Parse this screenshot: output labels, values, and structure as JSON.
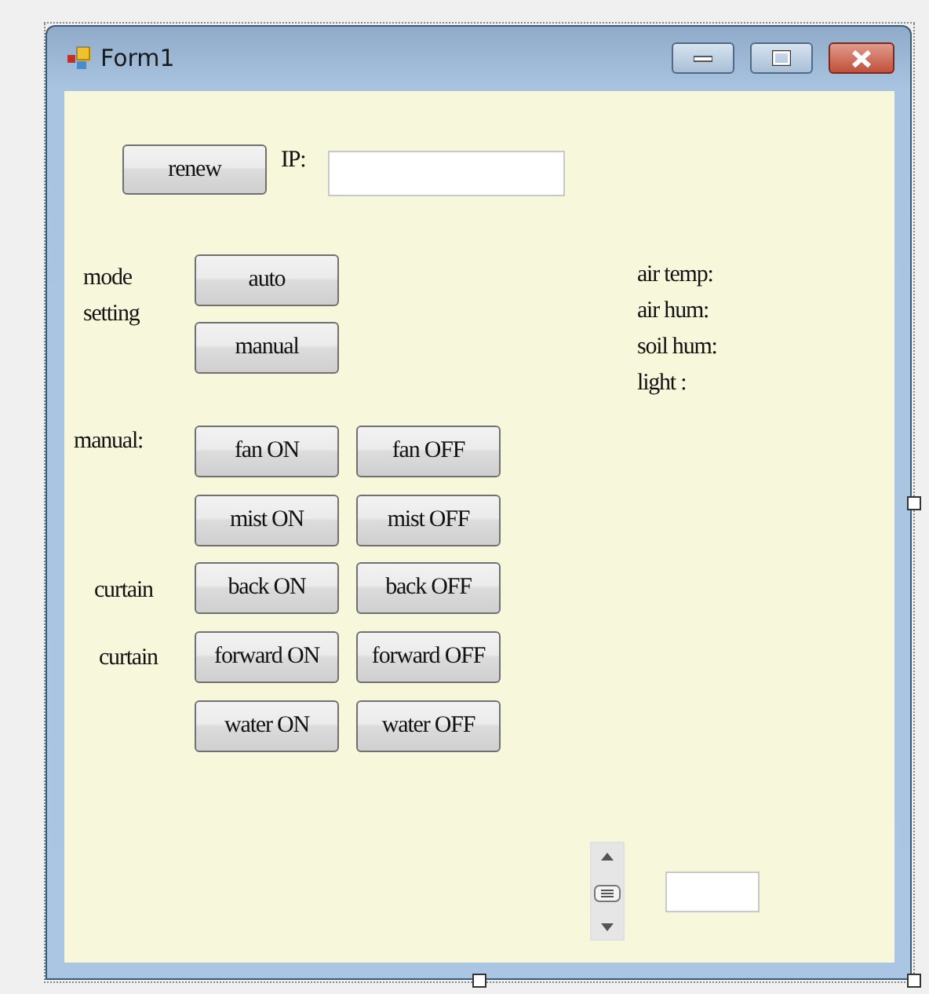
{
  "window": {
    "title": "Form1"
  },
  "controls": [
    {
      "kind": "button",
      "text": "renew"
    },
    {
      "kind": "label",
      "text": "IP:"
    },
    {
      "kind": "textbox"
    },
    {
      "kind": "label",
      "text": "mode"
    },
    {
      "kind": "label",
      "text": "setting"
    },
    {
      "kind": "button",
      "text": "auto"
    },
    {
      "kind": "button",
      "text": "manual"
    },
    {
      "kind": "label",
      "text": "air temp:"
    },
    {
      "kind": "label",
      "text": "air hum:"
    },
    {
      "kind": "label",
      "text": "soil hum:"
    },
    {
      "kind": "label",
      "text": "light :"
    },
    {
      "kind": "label",
      "text": "manual:"
    },
    {
      "kind": "button",
      "text": "fan ON"
    },
    {
      "kind": "button",
      "text": "fan OFF"
    },
    {
      "kind": "button",
      "text": "mist ON"
    },
    {
      "kind": "button",
      "text": "mist OFF"
    },
    {
      "kind": "label",
      "text": "curtain"
    },
    {
      "kind": "button",
      "text": "back ON"
    },
    {
      "kind": "button",
      "text": "back OFF"
    },
    {
      "kind": "label",
      "text": "curtain"
    },
    {
      "kind": "button",
      "text": "forward ON"
    },
    {
      "kind": "button",
      "text": "forward OFF"
    },
    {
      "kind": "button",
      "text": "water ON"
    },
    {
      "kind": "button",
      "text": "water OFF"
    },
    {
      "kind": "trackbar",
      "level": 0.5
    },
    {
      "kind": "textbox"
    }
  ]
}
